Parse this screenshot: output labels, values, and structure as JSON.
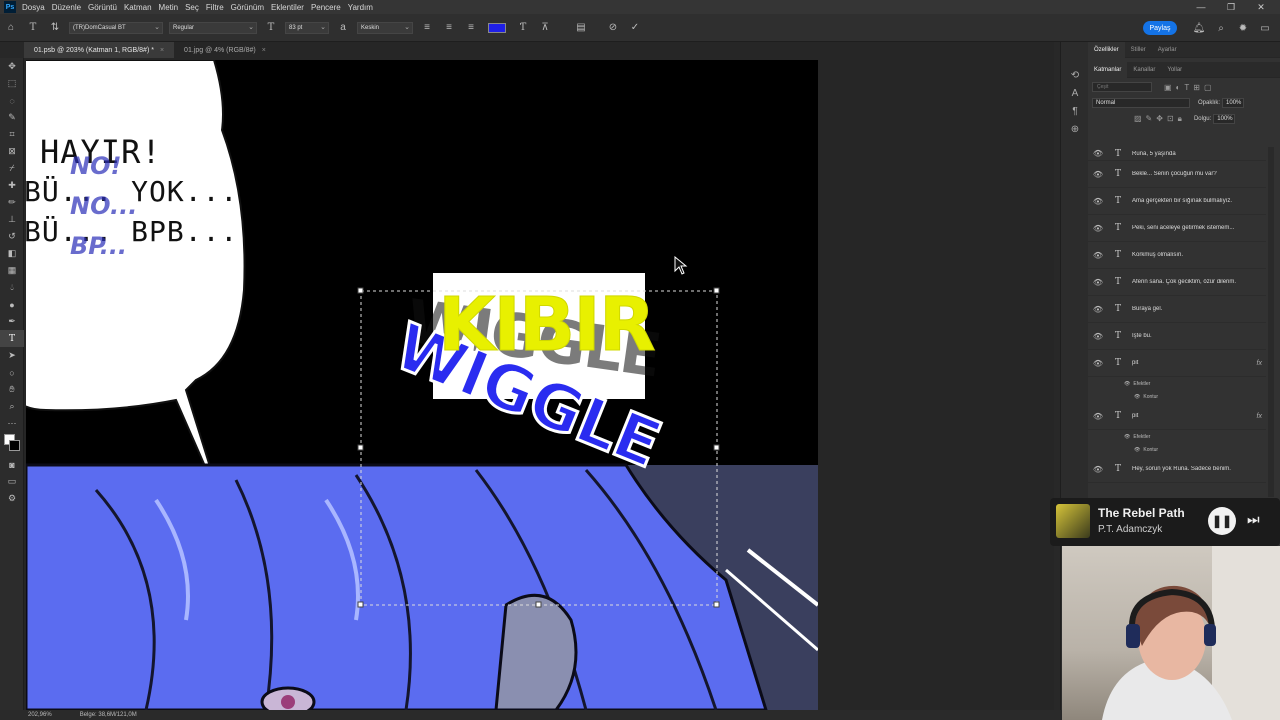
{
  "menubar": {
    "logo": "Ps",
    "items": [
      "Dosya",
      "Düzenle",
      "Görüntü",
      "Katman",
      "Metin",
      "Seç",
      "Filtre",
      "Görünüm",
      "Eklentiler",
      "Pencere",
      "Yardım"
    ],
    "minimize": "—",
    "restore": "❐",
    "close": "✕"
  },
  "options": {
    "font_family": "(TR)DomCasual BT",
    "font_style": "Regular",
    "font_size": "83 pt",
    "antialias": "Keskin",
    "text_color": "#1f1fe6",
    "share_label": "Paylaş"
  },
  "doctabs": [
    {
      "label": "01.psb @ 203% (Katman 1, RGB/8#) *",
      "close": "×"
    },
    {
      "label": "01.jpg @ 4% (RGB/8#)",
      "close": "×"
    }
  ],
  "canvas": {
    "bubble_lines": [
      "HAYIR!",
      "BÜ... YOK...",
      "BÜ... BPB..."
    ],
    "bubble_overlay": [
      "NO!",
      "NO...",
      "BP..."
    ],
    "sfx_blue": "WIGGLE",
    "sfx_yellow": "KIBIR",
    "sfx_ghost": "WIGGLE"
  },
  "status": {
    "zoom": "202,96%",
    "doc_info": "Belge: 38,6M/121,0M"
  },
  "panels": {
    "top_tabs": [
      "Özellikler",
      "Stiller",
      "Ayarlar"
    ],
    "layer_tabs": [
      "Katmanlar",
      "Kanallar",
      "Yollar"
    ],
    "search_placeholder": "Çeşit",
    "blend_mode": "Normal",
    "opacity_label": "Opaklık:",
    "opacity_value": "100%",
    "fill_label": "Dolgu:",
    "fill_value": "100%",
    "layers": [
      {
        "name": "Runa, 5 yaşında",
        "fx": ""
      },
      {
        "name": "Bekle... Senin çocuğun mu var?",
        "fx": ""
      },
      {
        "name": "Ama gerçekten bir sığınak bulmalıyız.",
        "fx": ""
      },
      {
        "name": "Peki, seni aceleye getirmek istemem...",
        "fx": ""
      },
      {
        "name": "Korkmuş olmalısın.",
        "fx": ""
      },
      {
        "name": "Aferin sana. Çok geciktim, özür dilerim.",
        "fx": ""
      },
      {
        "name": "Buraya gel.",
        "fx": ""
      },
      {
        "name": "İşte bu.",
        "fx": ""
      },
      {
        "name": "pit",
        "fx": "fx"
      },
      {
        "name": "pit",
        "fx": "fx"
      },
      {
        "name": "Hey, sorun yok Runa. Sadece benim.",
        "fx": ""
      }
    ],
    "effects_label": "Efektler",
    "stroke_label": "Kontur"
  },
  "music": {
    "title": "The Rebel Path",
    "artist": "P.T. Adamczyk"
  }
}
